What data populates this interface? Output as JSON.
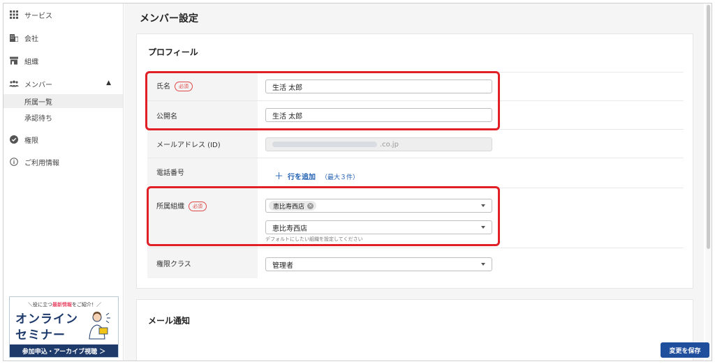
{
  "sidebar": {
    "items": [
      {
        "label": "サービス",
        "icon": "grid-icon"
      },
      {
        "label": "会社",
        "icon": "building-icon"
      },
      {
        "label": "組織",
        "icon": "store-icon"
      },
      {
        "label": "メンバー",
        "icon": "members-icon"
      },
      {
        "label": "権限",
        "icon": "shield-icon"
      },
      {
        "label": "ご利用情報",
        "icon": "info-icon"
      }
    ],
    "members_sub": [
      "所属一覧",
      "承認待ち"
    ]
  },
  "banner": {
    "tag_prefix": "＼役に立つ",
    "tag_highlight": "最新情報",
    "tag_suffix": "をご紹介！／",
    "line1": "オンライン",
    "line2": "セミナー",
    "cta": "参加申込・アーカイブ視聴 ＞"
  },
  "page": {
    "title": "メンバー設定"
  },
  "profile": {
    "title": "プロフィール",
    "required_badge": "必須",
    "name_label": "氏名",
    "name_value": "生活 太郎",
    "display_name_label": "公開名",
    "display_name_value": "生活 太郎",
    "email_label": "メールアドレス (ID)",
    "email_suffix": ".co.jp",
    "phone_label": "電話番号",
    "add_row": "行を追加",
    "add_row_max": "（最大３件）",
    "org_label": "所属組織",
    "org_chip": "恵比寿西店",
    "org_default": "恵比寿西店",
    "org_hint": "デフォルトにしたい組織を設定してください",
    "role_label": "権限クラス",
    "role_value": "管理者"
  },
  "mail": {
    "title": "メール通知"
  },
  "actions": {
    "save": "変更を保存"
  },
  "colors": {
    "highlight": "#e01f26",
    "primary": "#1f4f9c",
    "link": "#1f5fb3"
  }
}
